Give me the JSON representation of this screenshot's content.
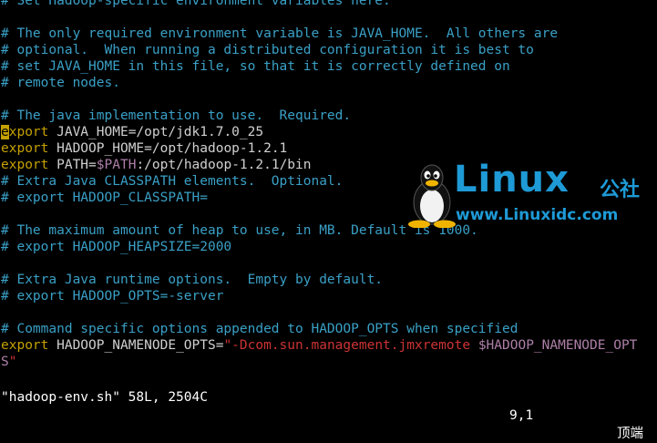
{
  "editor": {
    "lines": [
      {
        "segments": [
          {
            "cls": "comment",
            "text": "# Set Hadoop-specific environment variables here."
          }
        ]
      },
      {
        "segments": []
      },
      {
        "segments": [
          {
            "cls": "comment",
            "text": "# The only required environment variable is JAVA_HOME.  All others are"
          }
        ]
      },
      {
        "segments": [
          {
            "cls": "comment",
            "text": "# optional.  When running a distributed configuration it is best to"
          }
        ]
      },
      {
        "segments": [
          {
            "cls": "comment",
            "text": "# set JAVA_HOME in this file, so that it is correctly defined on"
          }
        ]
      },
      {
        "segments": [
          {
            "cls": "comment",
            "text": "# remote nodes."
          }
        ]
      },
      {
        "segments": []
      },
      {
        "segments": [
          {
            "cls": "comment",
            "text": "# The java implementation to use.  Required."
          }
        ]
      },
      {
        "segments": [
          {
            "cls": "cursor",
            "text": "e"
          },
          {
            "cls": "kw",
            "text": "xport"
          },
          {
            "cls": "plain",
            "text": " JAVA_HOME=/opt/jdk1.7.0_25"
          }
        ]
      },
      {
        "segments": [
          {
            "cls": "kw",
            "text": "export"
          },
          {
            "cls": "plain",
            "text": " HADOOP_HOME=/opt/hadoop-1.2.1"
          }
        ]
      },
      {
        "segments": [
          {
            "cls": "kw",
            "text": "export"
          },
          {
            "cls": "plain",
            "text": " PATH="
          },
          {
            "cls": "var",
            "text": "$PATH"
          },
          {
            "cls": "plain",
            "text": ":/opt/hadoop-1.2.1/bin"
          }
        ]
      },
      {
        "segments": [
          {
            "cls": "comment",
            "text": "# Extra Java CLASSPATH elements.  Optional."
          }
        ]
      },
      {
        "segments": [
          {
            "cls": "comment",
            "text": "# export HADOOP_CLASSPATH="
          }
        ]
      },
      {
        "segments": []
      },
      {
        "segments": [
          {
            "cls": "comment",
            "text": "# The maximum amount of heap to use, in MB. Default is 1000."
          }
        ]
      },
      {
        "segments": [
          {
            "cls": "comment",
            "text": "# export HADOOP_HEAPSIZE=2000"
          }
        ]
      },
      {
        "segments": []
      },
      {
        "segments": [
          {
            "cls": "comment",
            "text": "# Extra Java runtime options.  Empty by default."
          }
        ]
      },
      {
        "segments": [
          {
            "cls": "comment",
            "text": "# export HADOOP_OPTS=-server"
          }
        ]
      },
      {
        "segments": []
      },
      {
        "segments": [
          {
            "cls": "comment",
            "text": "# Command specific options appended to HADOOP_OPTS when specified"
          }
        ]
      },
      {
        "segments": [
          {
            "cls": "kw",
            "text": "export"
          },
          {
            "cls": "plain",
            "text": " HADOOP_NAMENODE_OPTS="
          },
          {
            "cls": "str",
            "text": "\"-Dcom.sun.management.jmxremote "
          },
          {
            "cls": "var",
            "text": "$HADOOP_NAMENODE_OPT"
          }
        ]
      },
      {
        "segments": [
          {
            "cls": "var",
            "text": "S"
          },
          {
            "cls": "str",
            "text": "\""
          }
        ]
      }
    ]
  },
  "statusline": {
    "file_info": "\"hadoop-env.sh\" 58L, 2504C",
    "position": "9,1",
    "scroll": "顶端"
  },
  "watermark": {
    "brand": "Linux",
    "brand_suffix": "公社",
    "url": "www.Linuxidc.com"
  }
}
